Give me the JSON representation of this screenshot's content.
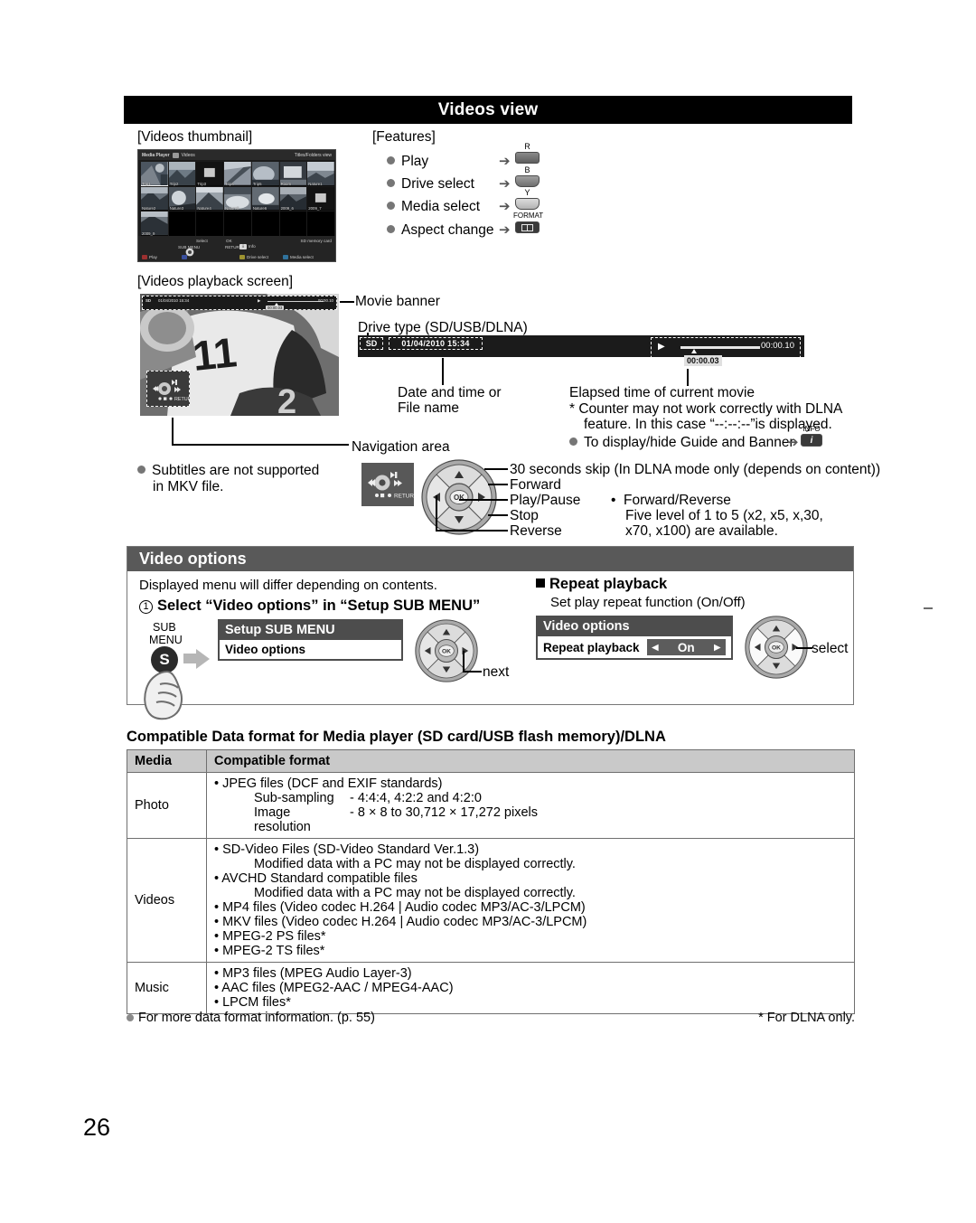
{
  "page_number": "26",
  "section": {
    "title": "Videos view"
  },
  "labels": {
    "videos_thumbnail": "[Videos thumbnail]",
    "features": "[Features]",
    "videos_playback_screen": "[Videos playback screen]",
    "movie_banner": "Movie banner",
    "drive_type": "Drive type (SD/USB/DLNA)",
    "date_time_or": "Date and time or",
    "file_name": "File name",
    "elapsed_time": "Elapsed time of current movie",
    "counter_note_1": "* Counter may not work correctly with DLNA",
    "counter_note_2": "feature. In this case “--:--:--”is displayed.",
    "display_hide": "To display/hide Guide and Banner",
    "navigation_area": "Navigation area",
    "subtitles_1": "Subtitles are not supported",
    "subtitles_2": "in MKV file."
  },
  "features": {
    "items": [
      {
        "label": "Play",
        "key": "R",
        "key_type": "red"
      },
      {
        "label": "Drive select",
        "key": "B",
        "key_type": "blue"
      },
      {
        "label": "Media select",
        "key": "Y",
        "key_type": "yellow"
      },
      {
        "label": "Aspect change",
        "key": "FORMAT",
        "key_type": "format"
      }
    ]
  },
  "tv_thumbnail": {
    "header_left": "Media Player",
    "header_mid": "Videos",
    "header_right": "Titles/Folders view",
    "cells": [
      {
        "name": "Trip1",
        "selected": true
      },
      {
        "name": "Trip2"
      },
      {
        "name": "Trip3"
      },
      {
        "name": "Trip4"
      },
      {
        "name": "Trip5"
      },
      {
        "name": "Room"
      },
      {
        "name": "Nature1"
      },
      {
        "name": "Nature2"
      },
      {
        "name": "Nature3"
      },
      {
        "name": "Nature4"
      },
      {
        "name": "Nature5"
      },
      {
        "name": "Nature6"
      },
      {
        "name": "2009_6"
      },
      {
        "name": "2009_7"
      },
      {
        "name": "2009_9"
      },
      {
        "name": "",
        "blank": true
      },
      {
        "name": "",
        "blank": true
      },
      {
        "name": "",
        "blank": true
      },
      {
        "name": "",
        "blank": true
      },
      {
        "name": "",
        "blank": true
      },
      {
        "name": "",
        "blank": true
      }
    ],
    "footer": {
      "select": "Select",
      "ok": "OK",
      "sub_menu": "SUB MENU",
      "return": "RETURN",
      "info": "Info",
      "info_glyph": "i",
      "media_label": "SD memory card",
      "keys": [
        {
          "label": "Play",
          "color": "#8a2b2b"
        },
        {
          "label": "",
          "color": "#3a3a8a"
        },
        {
          "label": "Drive select",
          "color": "#8a8a2b"
        },
        {
          "label": "Media select",
          "color": "#2b6f8a"
        }
      ]
    }
  },
  "playback_banner": {
    "drive": "SD",
    "datetime": "01/04/2010  15:34",
    "play_glyph": "▶",
    "total_time": "00:00.10",
    "current_time": "00:00.03"
  },
  "dpad_callouts": {
    "up": "30 seconds skip (In DLNA mode only (depends on content))",
    "right": "Forward",
    "ok": "Play/Pause",
    "down": "Stop",
    "left": "Reverse",
    "note_title": "Forward/Reverse",
    "note_line1": "Five level of 1 to 5 (x2, x5, x,30,",
    "note_line2": "x70, x100) are available.",
    "ok_label": "OK"
  },
  "video_options": {
    "header": "Video options",
    "intro": "Displayed menu will differ depending on contents.",
    "step1": "Select “Video options” in “Setup SUB MENU”",
    "step1_num": "1",
    "sub_menu_line1": "SUB",
    "sub_menu_line2": "MENU",
    "sub_menu_glyph": "S",
    "osd_setup_title": "Setup SUB MENU",
    "osd_setup_item": "Video options",
    "next_label": "next",
    "ok_label": "OK",
    "repeat_heading": "Repeat playback",
    "repeat_desc": "Set play repeat function (On/Off)",
    "osd_vo_title": "Video options",
    "osd_vo_item": "Repeat playback",
    "osd_vo_value": "On",
    "select_label": "select"
  },
  "compat_table": {
    "title": "Compatible Data format for Media player (SD card/USB flash memory)/DLNA",
    "headers": [
      "Media",
      "Compatible format"
    ],
    "rows": [
      {
        "media": "Photo",
        "lines": [
          "• JPEG files (DCF and EXIF standards)",
          "Sub-sampling",
          "- 4:4:4, 4:2:2 and 4:2:0",
          "Image resolution",
          "- 8 × 8 to 30,712 × 17,272 pixels"
        ]
      },
      {
        "media": "Videos",
        "lines": [
          "• SD-Video Files (SD-Video Standard Ver.1.3)",
          "Modified data with a PC may not be displayed correctly.",
          "• AVCHD Standard compatible files",
          "Modified data with a PC may not be displayed correctly.",
          "• MP4 files (Video codec H.264 | Audio codec MP3/AC-3/LPCM)",
          "• MKV files (Video codec H.264 | Audio codec MP3/AC-3/LPCM)",
          "• MPEG-2 PS files*",
          "• MPEG-2 TS files*"
        ]
      },
      {
        "media": "Music",
        "lines": [
          "• MP3 files (MPEG Audio Layer-3)",
          "• AAC files (MPEG2-AAC / MPEG4-AAC)",
          "• LPCM files*"
        ]
      }
    ],
    "footnote_left": "For more data format information. (p. 55)",
    "footnote_right": "* For DLNA only."
  }
}
